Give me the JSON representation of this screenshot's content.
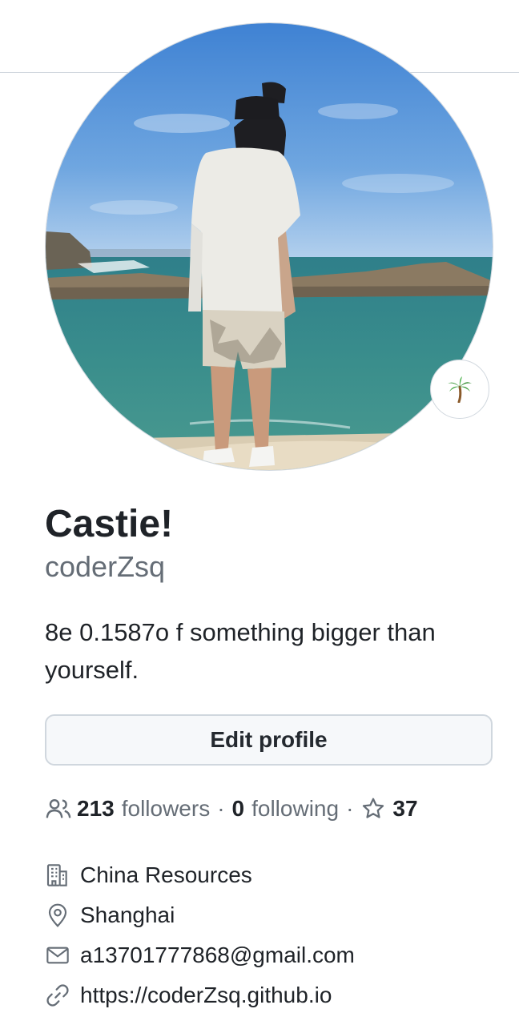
{
  "profile": {
    "name": "Castie!",
    "login": "coderZsq",
    "bio": "8e 0.1587o f something bigger than yourself.",
    "status_emoji": "🌴",
    "edit_button_label": "Edit profile"
  },
  "stats": {
    "followers_count": "213",
    "followers_label": "followers",
    "separator": "·",
    "following_count": "0",
    "following_label": "following",
    "stars_count": "37"
  },
  "details": {
    "company": "China Resources",
    "location": "Shanghai",
    "email": "a13701777868@gmail.com",
    "website": "https://coderZsq.github.io"
  },
  "icons": {
    "followers": "people-icon",
    "stars": "star-icon",
    "company": "organization-icon",
    "location": "location-pin-icon",
    "email": "mail-icon",
    "website": "link-icon"
  },
  "colors": {
    "text_primary": "#1f2328",
    "text_muted": "#656d76",
    "border": "#d0d7de",
    "button_bg": "#f6f8fa"
  }
}
